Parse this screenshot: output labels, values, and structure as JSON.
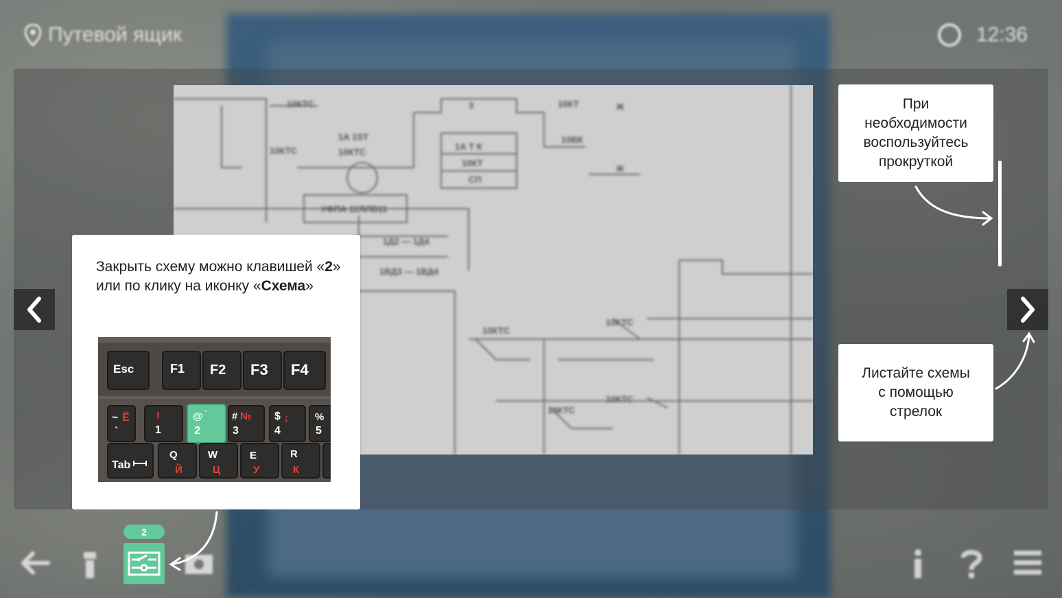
{
  "header": {
    "location": "Путевой ящик",
    "time": "12:36"
  },
  "tips": {
    "scroll": [
      "При",
      "необходимости",
      "воспользуйтесь",
      "прокруткой"
    ],
    "arrows": [
      "Листайте схемы",
      "с помощью",
      "стрелок"
    ],
    "close_part1": "Закрыть схему можно клавишей «",
    "close_key": "2",
    "close_part2": "» или по клику на иконку «",
    "close_icon_name": "Схема",
    "close_part3": "»"
  },
  "keyboard": {
    "row1": [
      "Esc",
      "F1",
      "F2",
      "F3",
      "F4"
    ],
    "row2": [
      {
        "top": "~",
        "top_ru": "Ё",
        "bottom": "`"
      },
      {
        "top": "!",
        "bottom": "1"
      },
      {
        "top": "@",
        "top_ru": "\"",
        "bottom": "2"
      },
      {
        "top": "#",
        "top_ru": "№",
        "bottom": "3"
      },
      {
        "top": "$",
        "top_ru": ";",
        "bottom": "4"
      },
      {
        "top": "%",
        "bottom": "5"
      }
    ],
    "row3": [
      {
        "top": "Tab",
        "bottom": ""
      },
      {
        "top": "Q",
        "bottom": "Й"
      },
      {
        "top": "W",
        "bottom": "Ц"
      },
      {
        "top": "E",
        "bottom": "У"
      },
      {
        "top": "R",
        "bottom": "К"
      }
    ]
  },
  "toolbar": {
    "schema_badge": "2"
  },
  "colors": {
    "accent": "#63c89a",
    "key_red": "#d9443b"
  }
}
